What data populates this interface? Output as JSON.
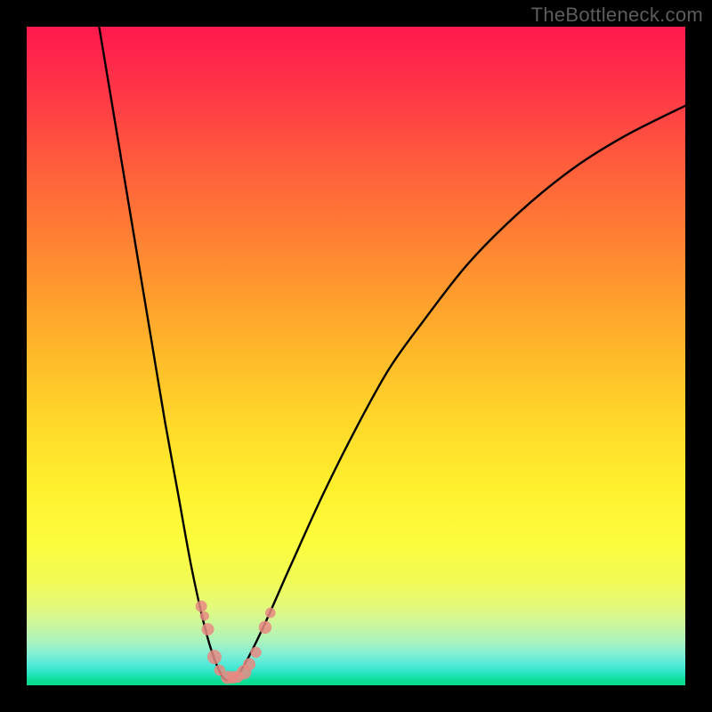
{
  "watermark": "TheBottleneck.com",
  "chart_data": {
    "type": "line",
    "title": "",
    "xlabel": "",
    "ylabel": "",
    "xlim": [
      0,
      100
    ],
    "ylim": [
      0,
      100
    ],
    "grid": false,
    "series": [
      {
        "name": "curve",
        "x": [
          11,
          13,
          15,
          17,
          19,
          21,
          23,
          25,
          27,
          28.5,
          30,
          31.5,
          33,
          36,
          40,
          45,
          50,
          55,
          60,
          67,
          75,
          83,
          91,
          100
        ],
        "y": [
          100,
          88,
          76,
          64,
          52,
          40,
          29,
          18,
          9,
          4,
          1,
          1.2,
          3,
          9,
          18,
          29,
          39,
          48,
          55,
          64,
          72,
          78.5,
          83.5,
          88
        ]
      }
    ],
    "points": {
      "name": "markers",
      "x": [
        26.5,
        27.0,
        27.5,
        28.5,
        29.3,
        30.5,
        31.3,
        32.0,
        33.0,
        33.8,
        34.8,
        36.2,
        37.0
      ],
      "y": [
        12.0,
        10.5,
        8.5,
        4.3,
        2.3,
        1.2,
        1.2,
        1.3,
        2.0,
        3.2,
        5.0,
        8.8,
        11.0
      ],
      "r": [
        6.5,
        5.2,
        7.0,
        8.0,
        6.2,
        7.5,
        7.0,
        6.8,
        8.2,
        7.0,
        6.2,
        7.2,
        5.8
      ]
    },
    "colors": {
      "curve": "#000000",
      "markers": "#e88a82",
      "gradient_top": "#ff1a4d",
      "gradient_bottom": "#07da88"
    }
  }
}
